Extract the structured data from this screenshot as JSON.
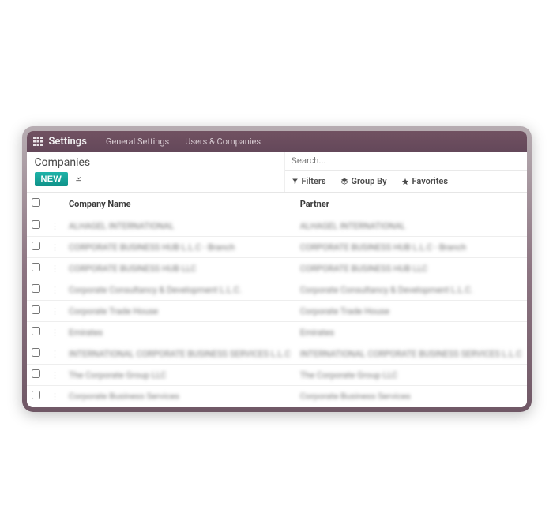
{
  "topbar": {
    "brand": "Settings",
    "menu": [
      "General Settings",
      "Users & Companies"
    ]
  },
  "breadcrumb": "Companies",
  "actions": {
    "new_label": "NEW"
  },
  "search": {
    "placeholder": "Search..."
  },
  "filters": {
    "filters_label": "Filters",
    "groupby_label": "Group By",
    "favorites_label": "Favorites"
  },
  "columns": {
    "company": "Company Name",
    "partner": "Partner"
  },
  "rows": [
    {
      "company": "ALHAGEL INTERNATIONAL",
      "partner": "ALHAGEL INTERNATIONAL"
    },
    {
      "company": "CORPORATE BUSINESS HUB L.L.C - Branch",
      "partner": "CORPORATE BUSINESS HUB L.L.C - Branch"
    },
    {
      "company": "CORPORATE BUSINESS HUB LLC",
      "partner": "CORPORATE BUSINESS HUB LLC"
    },
    {
      "company": "Corporate Consultancy & Development L.L.C.",
      "partner": "Corporate Consultancy & Development L.L.C."
    },
    {
      "company": "Corporate Trade House",
      "partner": "Corporate Trade House"
    },
    {
      "company": "Emirates",
      "partner": "Emirates"
    },
    {
      "company": "INTERNATIONAL CORPORATE BUSINESS SERVICES L.L.C",
      "partner": "INTERNATIONAL CORPORATE BUSINESS SERVICES L.L.C"
    },
    {
      "company": "The Corporate Group LLC",
      "partner": "The Corporate Group LLC"
    },
    {
      "company": "Corporate Business Services",
      "partner": "Corporate Business Services"
    }
  ]
}
